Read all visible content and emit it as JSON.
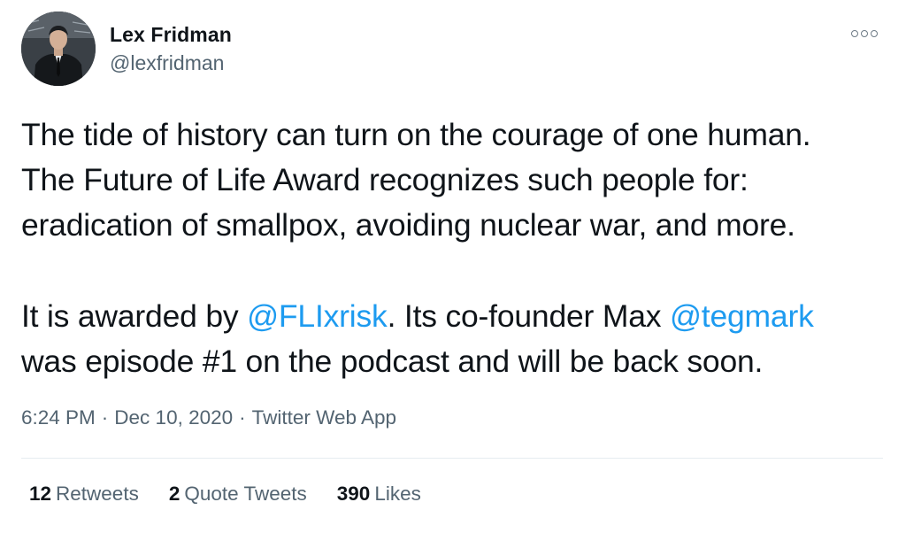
{
  "author": {
    "name": "Lex Fridman",
    "handle": "@lexfridman",
    "avatar_icon": "profile-photo"
  },
  "more_icon": "more-dots-icon",
  "tweet": {
    "line1": "The tide of history can turn on the courage of one human.",
    "line2": "The Future of Life Award recognizes such people for:",
    "line3": "eradication of smallpox, avoiding nuclear war, and more.",
    "line4_before": "It is awarded by ",
    "mention1": "@FLIxrisk",
    "line4_middle": ". Its co-founder Max ",
    "mention2": "@tegmark",
    "line5": "was episode #1 on the podcast and will be back soon."
  },
  "meta": {
    "time": "6:24 PM",
    "date": "Dec 10, 2020",
    "source": "Twitter Web App",
    "separator": "·"
  },
  "stats": {
    "retweets_count": "12",
    "retweets_label": "Retweets",
    "quotes_count": "2",
    "quotes_label": "Quote Tweets",
    "likes_count": "390",
    "likes_label": "Likes"
  },
  "colors": {
    "text": "#0f1419",
    "secondary": "#536471",
    "link": "#1d9bf0",
    "divider": "#e6ecf0"
  }
}
